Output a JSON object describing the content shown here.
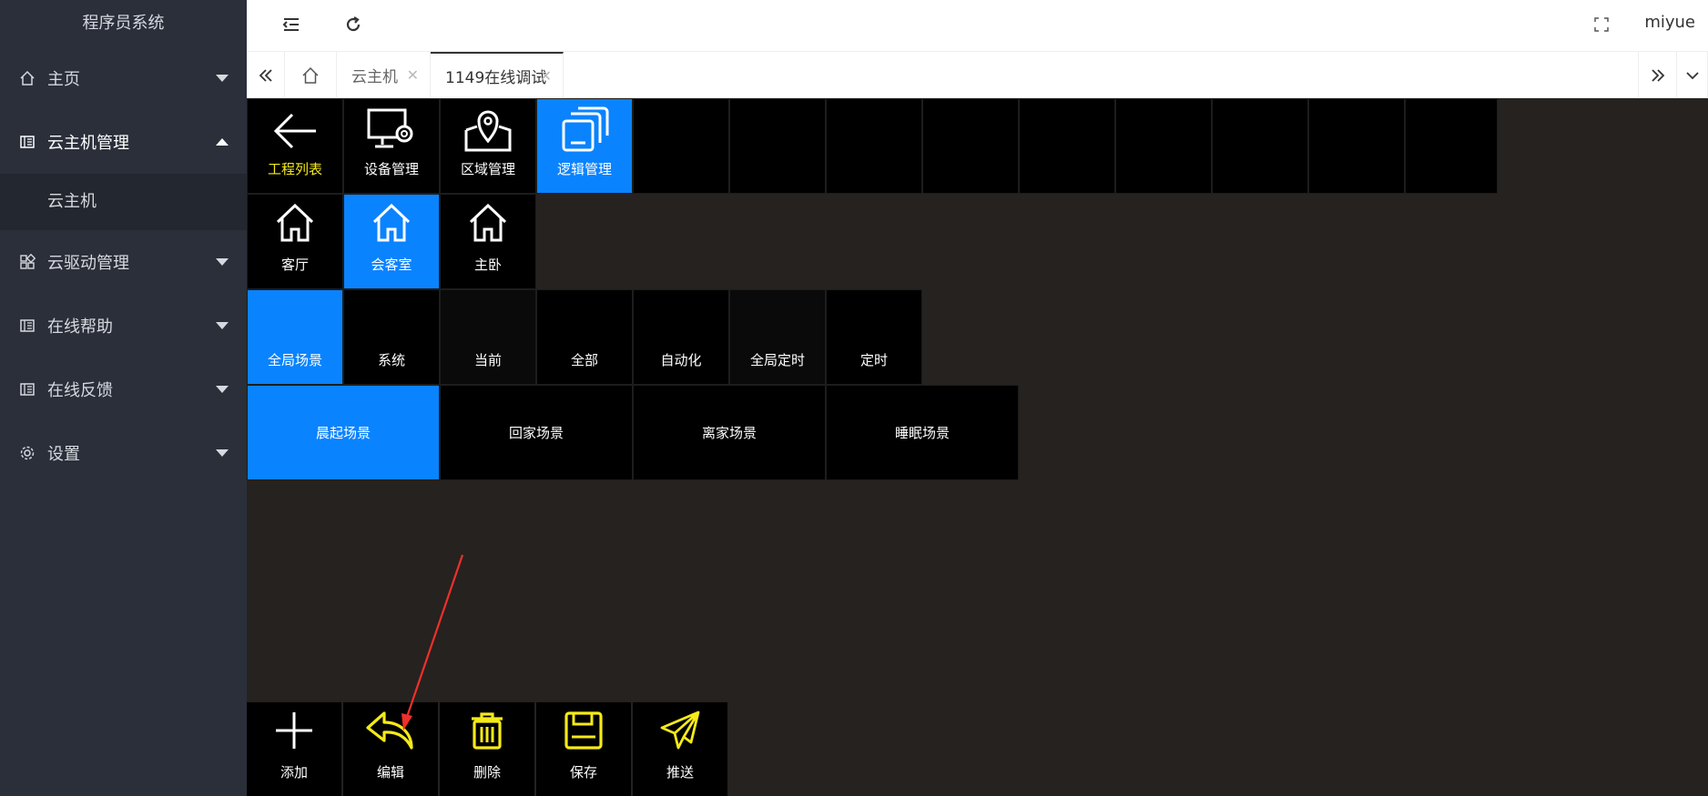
{
  "brand": {
    "title": "程序员系统"
  },
  "sidebar": {
    "items": [
      {
        "label": "主页",
        "icon": "home-icon",
        "expanded": false
      },
      {
        "label": "云主机管理",
        "icon": "server-icon",
        "expanded": true,
        "children": [
          {
            "label": "云主机"
          }
        ]
      },
      {
        "label": "云驱动管理",
        "icon": "grid-icon",
        "expanded": false
      },
      {
        "label": "在线帮助",
        "icon": "book-icon",
        "expanded": false
      },
      {
        "label": "在线反馈",
        "icon": "book-icon",
        "expanded": false
      },
      {
        "label": "设置",
        "icon": "gear-icon",
        "expanded": false
      }
    ]
  },
  "topbar": {
    "user": "miyue"
  },
  "tabs": [
    {
      "label": "云主机",
      "active": false
    },
    {
      "label": "1149在线调试",
      "active": true
    }
  ],
  "nav_row": [
    {
      "label": "工程列表",
      "icon": "back-arrow-icon",
      "selected": false,
      "label_color": "#f5ea18"
    },
    {
      "label": "设备管理",
      "icon": "monitor-gear-icon",
      "selected": false
    },
    {
      "label": "区域管理",
      "icon": "map-pin-icon",
      "selected": false
    },
    {
      "label": "逻辑管理",
      "icon": "layers-icon",
      "selected": true
    }
  ],
  "rooms": [
    {
      "label": "客厅",
      "selected": false
    },
    {
      "label": "会客室",
      "selected": true
    },
    {
      "label": "主卧",
      "selected": false
    }
  ],
  "scene_categories": [
    {
      "label": "全局场景",
      "selected": true
    },
    {
      "label": "系统",
      "selected": false
    },
    {
      "label": "当前",
      "selected": false
    },
    {
      "label": "全部",
      "selected": false
    },
    {
      "label": "自动化",
      "selected": false
    },
    {
      "label": "全局定时",
      "selected": false
    },
    {
      "label": "定时",
      "selected": false
    }
  ],
  "scenes": [
    {
      "label": "晨起场景",
      "selected": true
    },
    {
      "label": "回家场景",
      "selected": false
    },
    {
      "label": "离家场景",
      "selected": false
    },
    {
      "label": "睡眠场景",
      "selected": false
    }
  ],
  "actions": [
    {
      "label": "添加",
      "icon": "plus-icon"
    },
    {
      "label": "编辑",
      "icon": "reply-arrow-icon"
    },
    {
      "label": "删除",
      "icon": "trash-icon"
    },
    {
      "label": "保存",
      "icon": "save-icon"
    },
    {
      "label": "推送",
      "icon": "send-icon"
    }
  ],
  "colors": {
    "accent": "#0a83ff",
    "highlight": "#f5ea18",
    "annotation": "#f0302a"
  }
}
